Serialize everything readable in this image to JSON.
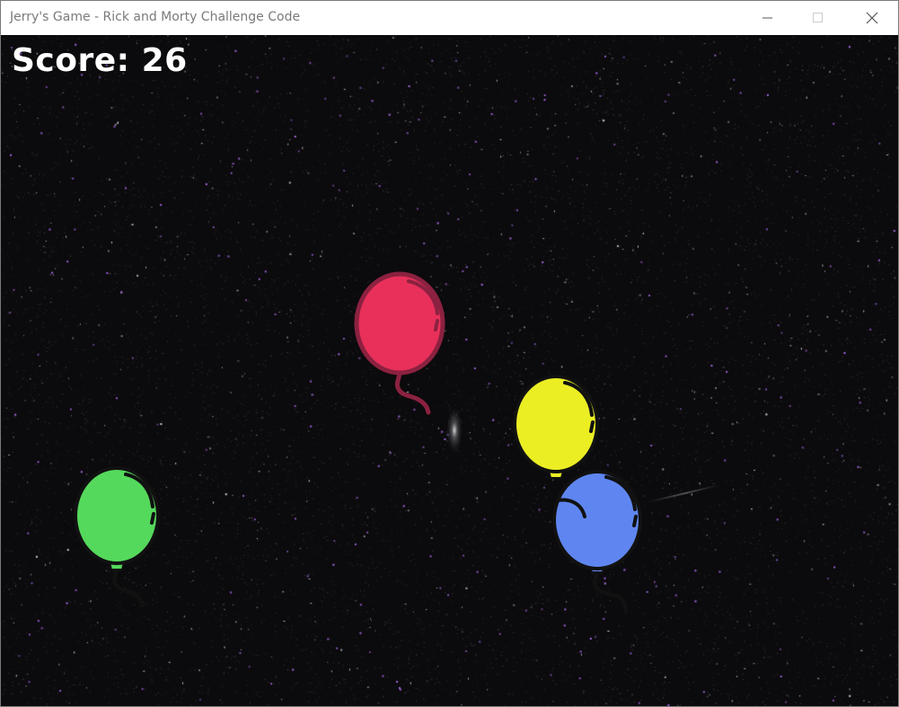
{
  "window": {
    "title": "Jerry's Game - Rick and Morty Challenge Code",
    "controls": [
      "minimize-icon",
      "maximize-icon",
      "close-icon"
    ]
  },
  "hud": {
    "score_label": "Score: 26"
  },
  "balloons": [
    {
      "color": "red",
      "fill": "#e8305a",
      "outline": "#8b2140"
    },
    {
      "color": "yellow",
      "fill": "#ecee24",
      "outline": "#111111"
    },
    {
      "color": "blue",
      "fill": "#5f86f0",
      "outline": "#111111"
    },
    {
      "color": "green",
      "fill": "#55d95c",
      "outline": "#111111"
    }
  ],
  "colors": {
    "background": "#0b0a0c",
    "titlebar": "#ffffff",
    "title_text": "#7a7a7a",
    "score_text": "#ffffff"
  }
}
